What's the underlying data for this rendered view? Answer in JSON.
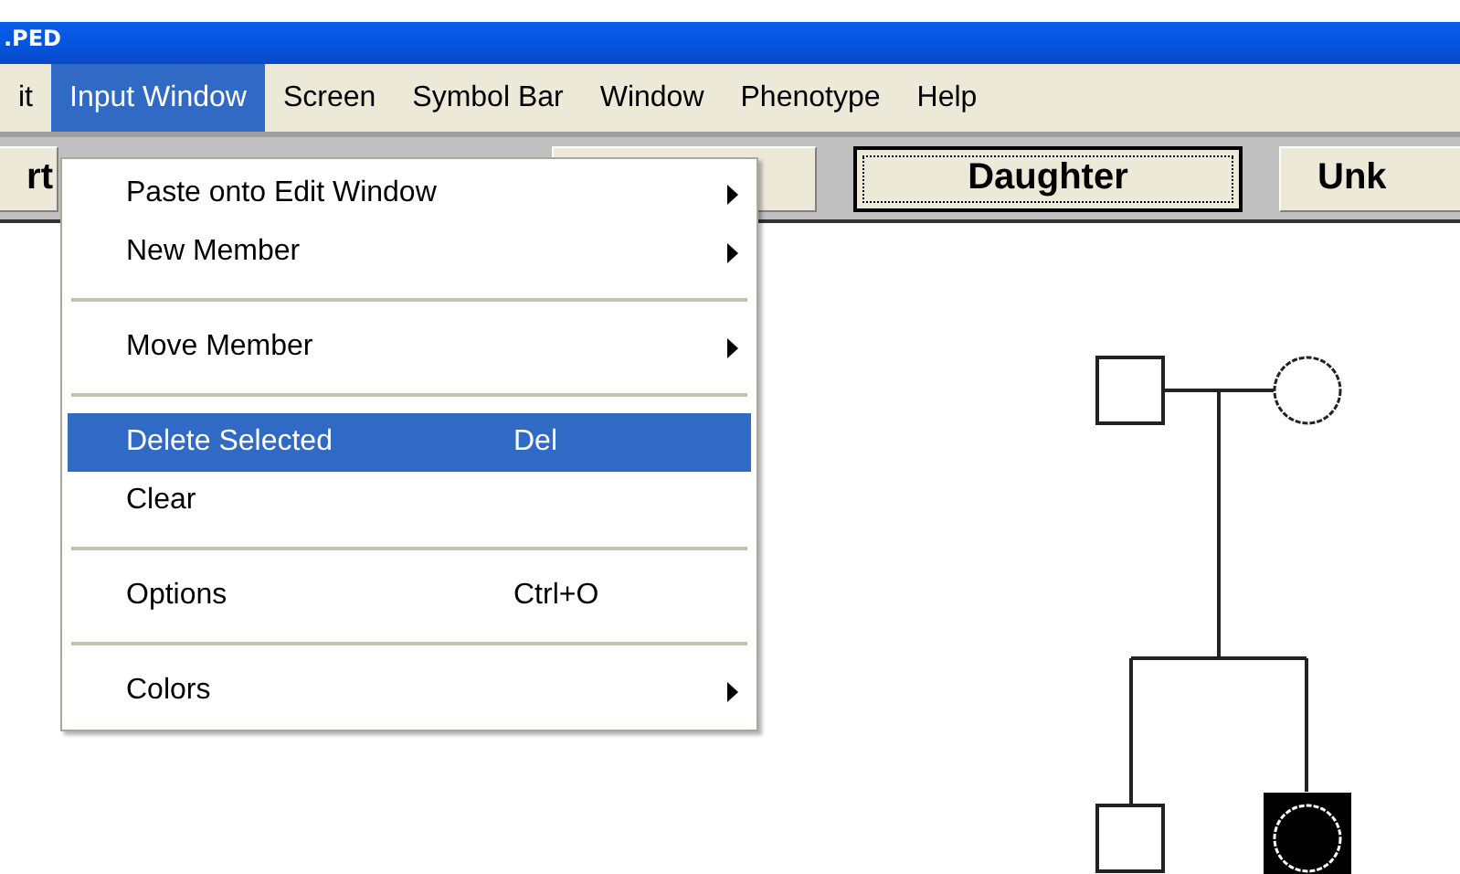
{
  "window": {
    "title": ".PED"
  },
  "menu_bar": [
    {
      "label": "it",
      "selected": false
    },
    {
      "label": "Input Window",
      "selected": true
    },
    {
      "label": "Screen",
      "selected": false
    },
    {
      "label": "Symbol Bar",
      "selected": false
    },
    {
      "label": "Window",
      "selected": false
    },
    {
      "label": "Phenotype",
      "selected": false
    },
    {
      "label": "Help",
      "selected": false
    }
  ],
  "toolbar": {
    "buttons": [
      {
        "label": "rt",
        "focused": false
      },
      {
        "label": "Daughter",
        "focused": true
      },
      {
        "label": "Unk",
        "focused": false
      }
    ]
  },
  "dropdown": {
    "items": [
      {
        "kind": "item",
        "label": "Paste onto Edit Window",
        "submenu": true,
        "selected": false
      },
      {
        "kind": "item",
        "label": "New Member",
        "submenu": true,
        "selected": false
      },
      {
        "kind": "separator"
      },
      {
        "kind": "item",
        "label": "Move Member",
        "submenu": true,
        "selected": false
      },
      {
        "kind": "separator"
      },
      {
        "kind": "item",
        "label": "Delete Selected",
        "shortcut": "Del",
        "submenu": false,
        "selected": true
      },
      {
        "kind": "item",
        "label": "Clear",
        "submenu": false,
        "selected": false
      },
      {
        "kind": "separator"
      },
      {
        "kind": "item",
        "label": "Options",
        "shortcut": "Ctrl+O",
        "submenu": false,
        "selected": false
      },
      {
        "kind": "separator"
      },
      {
        "kind": "item",
        "label": "Colors",
        "submenu": true,
        "selected": false
      }
    ]
  },
  "pedigree": {
    "members": [
      {
        "kind": "male",
        "selected": false
      },
      {
        "kind": "female",
        "selected": false
      },
      {
        "kind": "male",
        "selected": false
      },
      {
        "kind": "female",
        "selected": true
      }
    ]
  }
}
